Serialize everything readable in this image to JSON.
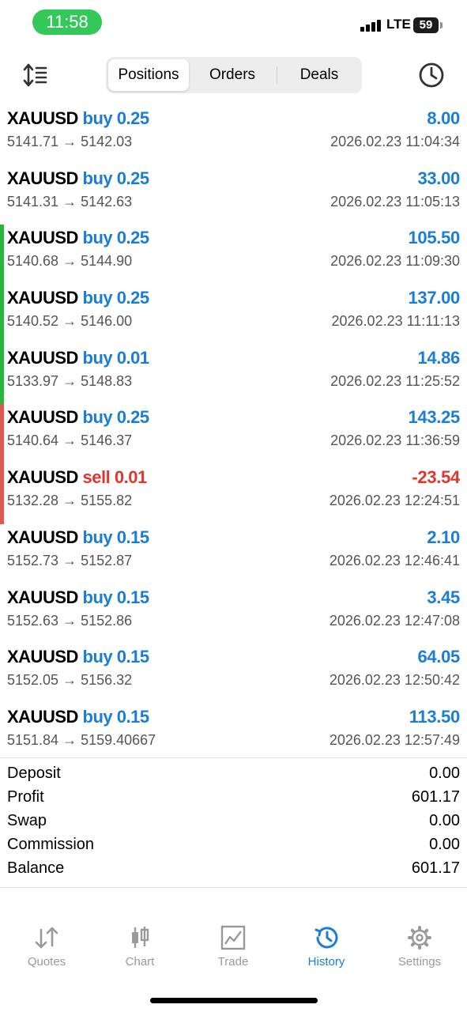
{
  "status_bar": {
    "time": "11:58",
    "network": "LTE",
    "battery": "59"
  },
  "header": {
    "tabs": [
      {
        "label": "Positions",
        "active": true
      },
      {
        "label": "Orders",
        "active": false
      },
      {
        "label": "Deals",
        "active": false
      }
    ],
    "sort_icon": "sort-icon",
    "period_icon": "clock-icon"
  },
  "colors": {
    "buy": "#1a7ed6",
    "sell": "#e0362c",
    "profit_bar": "#2ab53e",
    "loss_bar": "#e0584d",
    "accent": "#1a7ed6"
  },
  "deals": [
    {
      "symbol": "XAUUSD",
      "action": "buy",
      "volume": "0.25",
      "profit": "8.00",
      "prices": "5141.71 → 5142.03",
      "datetime": "2026.02.23 11:04:34",
      "marker": "none"
    },
    {
      "symbol": "XAUUSD",
      "action": "buy",
      "volume": "0.25",
      "profit": "33.00",
      "prices": "5141.31 → 5142.63",
      "datetime": "2026.02.23 11:05:13",
      "marker": "none"
    },
    {
      "symbol": "XAUUSD",
      "action": "buy",
      "volume": "0.25",
      "profit": "105.50",
      "prices": "5140.68 → 5144.90",
      "datetime": "2026.02.23 11:09:30",
      "marker": "green"
    },
    {
      "symbol": "XAUUSD",
      "action": "buy",
      "volume": "0.25",
      "profit": "137.00",
      "prices": "5140.52 → 5146.00",
      "datetime": "2026.02.23 11:11:13",
      "marker": "green"
    },
    {
      "symbol": "XAUUSD",
      "action": "buy",
      "volume": "0.01",
      "profit": "14.86",
      "prices": "5133.97 → 5148.83",
      "datetime": "2026.02.23 11:25:52",
      "marker": "green"
    },
    {
      "symbol": "XAUUSD",
      "action": "buy",
      "volume": "0.25",
      "profit": "143.25",
      "prices": "5140.64 → 5146.37",
      "datetime": "2026.02.23 11:36:59",
      "marker": "red"
    },
    {
      "symbol": "XAUUSD",
      "action": "sell",
      "volume": "0.01",
      "profit": "-23.54",
      "prices": "5132.28 → 5155.82",
      "datetime": "2026.02.23 12:24:51",
      "marker": "red"
    },
    {
      "symbol": "XAUUSD",
      "action": "buy",
      "volume": "0.15",
      "profit": "2.10",
      "prices": "5152.73 → 5152.87",
      "datetime": "2026.02.23 12:46:41",
      "marker": "none"
    },
    {
      "symbol": "XAUUSD",
      "action": "buy",
      "volume": "0.15",
      "profit": "3.45",
      "prices": "5152.63 → 5152.86",
      "datetime": "2026.02.23 12:47:08",
      "marker": "none"
    },
    {
      "symbol": "XAUUSD",
      "action": "buy",
      "volume": "0.15",
      "profit": "64.05",
      "prices": "5152.05 → 5156.32",
      "datetime": "2026.02.23 12:50:42",
      "marker": "none"
    },
    {
      "symbol": "XAUUSD",
      "action": "buy",
      "volume": "0.15",
      "profit": "113.50",
      "prices": "5151.84 → 5159.40667",
      "datetime": "2026.02.23 12:57:49",
      "marker": "none"
    }
  ],
  "summary": [
    {
      "label": "Deposit",
      "value": "0.00"
    },
    {
      "label": "Profit",
      "value": "601.17"
    },
    {
      "label": "Swap",
      "value": "0.00"
    },
    {
      "label": "Commission",
      "value": "0.00"
    },
    {
      "label": "Balance",
      "value": "601.17"
    }
  ],
  "tabbar": [
    {
      "label": "Quotes",
      "icon": "quotes-icon",
      "active": false
    },
    {
      "label": "Chart",
      "icon": "candlestick-icon",
      "active": false
    },
    {
      "label": "Trade",
      "icon": "trade-chart-icon",
      "active": false
    },
    {
      "label": "History",
      "icon": "history-icon",
      "active": true
    },
    {
      "label": "Settings",
      "icon": "gear-icon",
      "active": false
    }
  ]
}
